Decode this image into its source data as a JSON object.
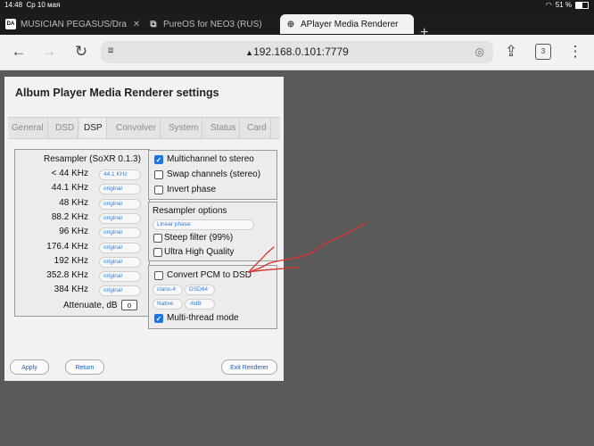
{
  "status_bar": {
    "time": "14:48",
    "date": "Ср 10 мая",
    "battery": "51 %",
    "battery_level": 0.51
  },
  "browser": {
    "tabs": [
      {
        "favicon": "DA",
        "title": "MUSICIAN PEGASUS/Dra",
        "active": false
      },
      {
        "favicon": "puzzle-icon",
        "title": "PureOS for NEO3 (RUS)",
        "active": false
      },
      {
        "favicon": "globe-icon",
        "title": "APlayer Media Renderer",
        "active": true
      }
    ],
    "new_tab": "+",
    "address": "192.168.0.101:7779",
    "tab_count": "3"
  },
  "page": {
    "title": "Album Player Media Renderer settings",
    "tabs": [
      "General",
      "DSD",
      "DSP",
      "Convolver",
      "System",
      "Status",
      "Card"
    ],
    "active_tab": "DSP",
    "resampler": {
      "title": "Resampler (SoXR 0.1.3)",
      "rows": [
        {
          "label": "< 44 KHz",
          "value": "44.1 KHz"
        },
        {
          "label": "44.1 KHz",
          "value": "original"
        },
        {
          "label": "48 KHz",
          "value": "original"
        },
        {
          "label": "88.2 KHz",
          "value": "original"
        },
        {
          "label": "96 KHz",
          "value": "original"
        },
        {
          "label": "176.4 KHz",
          "value": "original"
        },
        {
          "label": "192 KHz",
          "value": "original"
        },
        {
          "label": "352.8 KHz",
          "value": "original"
        },
        {
          "label": "384 KHz",
          "value": "original"
        }
      ],
      "attenuate_label": "Attenuate, dB",
      "attenuate_value": "0"
    },
    "channels": [
      {
        "label": "Multichannel to stereo",
        "checked": true
      },
      {
        "label": "Swap channels (stereo)",
        "checked": false
      },
      {
        "label": "Invert phase",
        "checked": false
      }
    ],
    "resampler_options": {
      "title": "Resampler options",
      "phase": "Linear phase",
      "steep": {
        "label": "Steep filter (99%)",
        "checked": false
      },
      "uhq": {
        "label": "Ultra High Quality",
        "checked": false
      }
    },
    "dsd": {
      "convert": {
        "label": "Convert PCM to DSD",
        "checked": false
      },
      "modulator": "clans-4",
      "rate": "DSD64",
      "mode": "Native",
      "gain": "-6dB",
      "multithread": {
        "label": "Multi-thread mode",
        "checked": true
      }
    },
    "buttons": {
      "apply": "Apply",
      "return": "Return",
      "exit": "Exit Renderer"
    }
  },
  "colors": {
    "accent": "#1a73e8",
    "annotation": "#e0312f",
    "backdrop": "#5a5a5a"
  }
}
